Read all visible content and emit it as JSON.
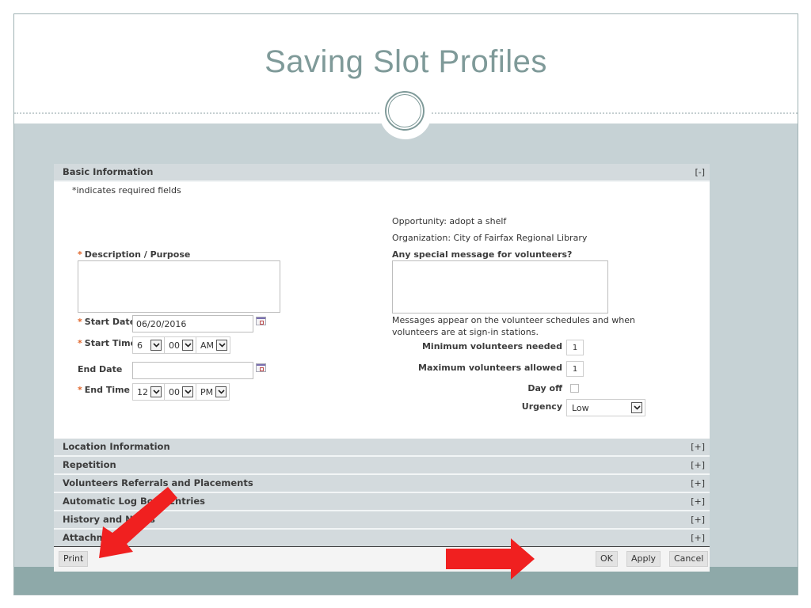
{
  "slide": {
    "title": "Saving Slot Profiles"
  },
  "basic_information": {
    "header": "Basic Information",
    "toggle": "[-]",
    "required_note": "*indicates required fields",
    "opportunity": "Opportunity: adopt a shelf",
    "organization": "Organization: City of Fairfax Regional Library",
    "description_label": "Description / Purpose",
    "description_value": "",
    "special_message_label": "Any special message for volunteers?",
    "special_message_value": "",
    "special_message_help": "Messages appear on the volunteer schedules and when volunteers are at sign-in stations.",
    "start_date_label": "Start Date",
    "start_date_value": "06/20/2016",
    "start_time_label": "Start Time",
    "start_time": {
      "hour": "6",
      "minute": "00",
      "ampm": "AM"
    },
    "end_date_label": "End Date",
    "end_date_value": "",
    "end_time_label": "End Time",
    "end_time": {
      "hour": "12",
      "minute": "00",
      "ampm": "PM"
    },
    "min_volunteers_label": "Minimum volunteers needed",
    "min_volunteers_value": "1",
    "max_volunteers_label": "Maximum volunteers allowed",
    "max_volunteers_value": "1",
    "day_off_label": "Day off",
    "day_off_checked": false,
    "urgency_label": "Urgency",
    "urgency_value": "Low",
    "required_marker": "*"
  },
  "sections": [
    {
      "label": "Location Information",
      "toggle": "[+]"
    },
    {
      "label": "Repetition",
      "toggle": "[+]"
    },
    {
      "label": "Volunteers Referrals and Placements",
      "toggle": "[+]"
    },
    {
      "label": "Automatic Log Book Entries",
      "toggle": "[+]"
    },
    {
      "label": "History and Notes",
      "toggle": "[+]"
    },
    {
      "label": "Attachments",
      "toggle": "[+]"
    }
  ],
  "footer": {
    "print": "Print",
    "ok": "OK",
    "apply": "Apply",
    "cancel": "Cancel"
  },
  "colors": {
    "title": "#7f9a99",
    "band": "#c6d2d5",
    "band_bottom": "#8ea9a9",
    "section_header": "#d3dadd",
    "required_star": "#e0652a",
    "annotation_arrow": "#f02020"
  }
}
